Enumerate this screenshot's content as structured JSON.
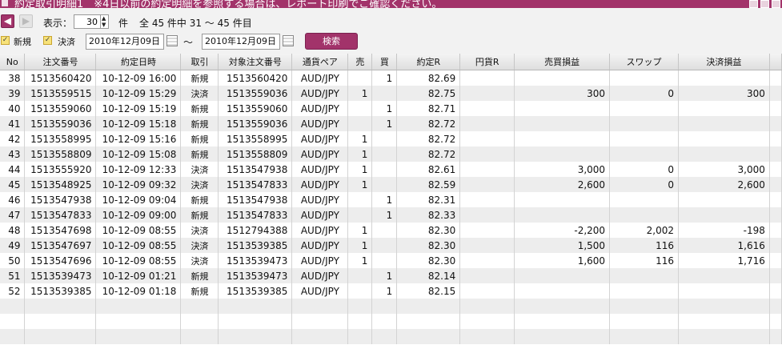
{
  "window": {
    "title": "約定取引明細1　※4日以前の約定明細を参照する場合は、レポート印刷でご確認ください。"
  },
  "toolbar": {
    "display_label": "表示：",
    "per_page": "30",
    "unit": "件",
    "summary": "全 45 件中 31 ～ 45 件目",
    "prev_icon": "arrow-left-icon",
    "next_icon": "arrow-right-icon"
  },
  "filter": {
    "new_label": "新規",
    "settle_label": "決済",
    "date_from": "2010年12月09日",
    "tilde": "～",
    "date_to": "2010年12月09日",
    "search_label": "検索"
  },
  "table": {
    "headers": [
      "No",
      "注文番号",
      "約定日時",
      "取引",
      "対象注文番号",
      "通貨ペア",
      "売",
      "買",
      "約定R",
      "円貨R",
      "売買損益",
      "スワップ",
      "決済損益"
    ],
    "rows": [
      {
        "no": "38",
        "order": "1513560420",
        "dt": "10-12-09 16:00",
        "type": "新規",
        "target": "1513560420",
        "pair": "AUD/JPY",
        "sell": "",
        "buy": "1",
        "rate": "82.69",
        "yen": "",
        "pl": "",
        "swap": "",
        "settle": ""
      },
      {
        "no": "39",
        "order": "1513559515",
        "dt": "10-12-09 15:29",
        "type": "決済",
        "target": "1513559036",
        "pair": "AUD/JPY",
        "sell": "1",
        "buy": "",
        "rate": "82.75",
        "yen": "",
        "pl": "300",
        "swap": "0",
        "settle": "300"
      },
      {
        "no": "40",
        "order": "1513559060",
        "dt": "10-12-09 15:19",
        "type": "新規",
        "target": "1513559060",
        "pair": "AUD/JPY",
        "sell": "",
        "buy": "1",
        "rate": "82.71",
        "yen": "",
        "pl": "",
        "swap": "",
        "settle": ""
      },
      {
        "no": "41",
        "order": "1513559036",
        "dt": "10-12-09 15:18",
        "type": "新規",
        "target": "1513559036",
        "pair": "AUD/JPY",
        "sell": "",
        "buy": "1",
        "rate": "82.72",
        "yen": "",
        "pl": "",
        "swap": "",
        "settle": ""
      },
      {
        "no": "42",
        "order": "1513558995",
        "dt": "10-12-09 15:16",
        "type": "新規",
        "target": "1513558995",
        "pair": "AUD/JPY",
        "sell": "1",
        "buy": "",
        "rate": "82.72",
        "yen": "",
        "pl": "",
        "swap": "",
        "settle": ""
      },
      {
        "no": "43",
        "order": "1513558809",
        "dt": "10-12-09 15:08",
        "type": "新規",
        "target": "1513558809",
        "pair": "AUD/JPY",
        "sell": "1",
        "buy": "",
        "rate": "82.72",
        "yen": "",
        "pl": "",
        "swap": "",
        "settle": ""
      },
      {
        "no": "44",
        "order": "1513555920",
        "dt": "10-12-09 12:33",
        "type": "決済",
        "target": "1513547938",
        "pair": "AUD/JPY",
        "sell": "1",
        "buy": "",
        "rate": "82.61",
        "yen": "",
        "pl": "3,000",
        "swap": "0",
        "settle": "3,000"
      },
      {
        "no": "45",
        "order": "1513548925",
        "dt": "10-12-09 09:32",
        "type": "決済",
        "target": "1513547833",
        "pair": "AUD/JPY",
        "sell": "1",
        "buy": "",
        "rate": "82.59",
        "yen": "",
        "pl": "2,600",
        "swap": "0",
        "settle": "2,600"
      },
      {
        "no": "46",
        "order": "1513547938",
        "dt": "10-12-09 09:04",
        "type": "新規",
        "target": "1513547938",
        "pair": "AUD/JPY",
        "sell": "",
        "buy": "1",
        "rate": "82.31",
        "yen": "",
        "pl": "",
        "swap": "",
        "settle": ""
      },
      {
        "no": "47",
        "order": "1513547833",
        "dt": "10-12-09 09:00",
        "type": "新規",
        "target": "1513547833",
        "pair": "AUD/JPY",
        "sell": "",
        "buy": "1",
        "rate": "82.33",
        "yen": "",
        "pl": "",
        "swap": "",
        "settle": ""
      },
      {
        "no": "48",
        "order": "1513547698",
        "dt": "10-12-09 08:55",
        "type": "決済",
        "target": "1512794388",
        "pair": "AUD/JPY",
        "sell": "1",
        "buy": "",
        "rate": "82.30",
        "yen": "",
        "pl": "-2,200",
        "swap": "2,002",
        "settle": "-198"
      },
      {
        "no": "49",
        "order": "1513547697",
        "dt": "10-12-09 08:55",
        "type": "決済",
        "target": "1513539385",
        "pair": "AUD/JPY",
        "sell": "1",
        "buy": "",
        "rate": "82.30",
        "yen": "",
        "pl": "1,500",
        "swap": "116",
        "settle": "1,616"
      },
      {
        "no": "50",
        "order": "1513547696",
        "dt": "10-12-09 08:55",
        "type": "決済",
        "target": "1513539473",
        "pair": "AUD/JPY",
        "sell": "1",
        "buy": "",
        "rate": "82.30",
        "yen": "",
        "pl": "1,600",
        "swap": "116",
        "settle": "1,716"
      },
      {
        "no": "51",
        "order": "1513539473",
        "dt": "10-12-09 01:21",
        "type": "新規",
        "target": "1513539473",
        "pair": "AUD/JPY",
        "sell": "",
        "buy": "1",
        "rate": "82.14",
        "yen": "",
        "pl": "",
        "swap": "",
        "settle": ""
      },
      {
        "no": "52",
        "order": "1513539385",
        "dt": "10-12-09 01:18",
        "type": "新規",
        "target": "1513539385",
        "pair": "AUD/JPY",
        "sell": "",
        "buy": "1",
        "rate": "82.15",
        "yen": "",
        "pl": "",
        "swap": "",
        "settle": ""
      }
    ]
  },
  "colors": {
    "accent": "#a2336a",
    "row_alt": "#ededed"
  }
}
